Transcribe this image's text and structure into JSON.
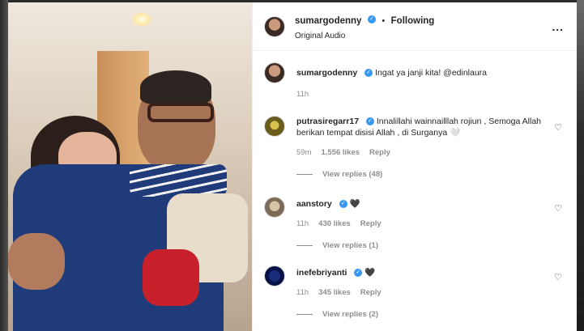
{
  "header": {
    "username": "sumargodenny",
    "verified_mark": "✓",
    "separator": "•",
    "follow_label": "Following",
    "audio_label": "Original Audio",
    "more_icon": "..."
  },
  "caption": {
    "username": "sumargodenny",
    "text": "Ingat ya janji kita! @edinlaura",
    "time": "11h"
  },
  "comments": [
    {
      "username": "putrasiregarr17",
      "text": "Innalillahi wainnailllah rojiun , Semoga Allah berikan tempat disisi Allah , di Surganya 🤍",
      "time": "59m",
      "likes": "1,556 likes",
      "reply_label": "Reply",
      "view_replies": "View replies (48)"
    },
    {
      "username": "aanstory",
      "text": "🖤",
      "time": "11h",
      "likes": "430 likes",
      "reply_label": "Reply",
      "view_replies": "View replies (1)"
    },
    {
      "username": "inefebriyanti",
      "text": "🖤",
      "time": "11h",
      "likes": "345 likes",
      "reply_label": "Reply",
      "view_replies": "View replies (2)"
    }
  ],
  "icons": {
    "heart": "heart-outline-icon"
  }
}
